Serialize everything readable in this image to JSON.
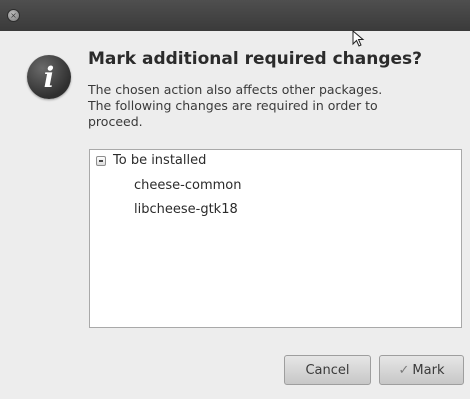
{
  "window": {
    "close_glyph": "×"
  },
  "dialog": {
    "icon_glyph": "i",
    "icon_name": "info-icon",
    "title": "Mark additional required changes?",
    "message_lines": [
      "The chosen action also affects other packages.",
      "The following changes are required in order to",
      "proceed."
    ]
  },
  "tree": {
    "group_label": "To be installed",
    "items": [
      "cheese-common",
      "libcheese-gtk18"
    ]
  },
  "buttons": {
    "cancel_label": "Cancel",
    "mark_label": "Mark",
    "mark_icon_glyph": "✓"
  },
  "colors": {
    "titlebar": "#3f3f3f",
    "dialog_bg": "#ededed",
    "text": "#2b2b2b"
  }
}
